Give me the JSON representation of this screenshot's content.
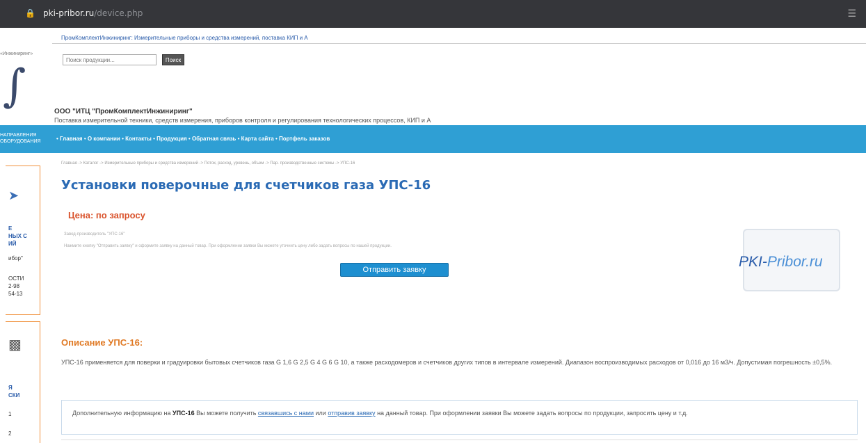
{
  "browser": {
    "url_domain": "pki-pribor.ru",
    "url_path": "/device.php"
  },
  "header": {
    "top_link": "ПромКомплектИнжиниринг: Измерительные приборы и средства измерений, поставка КИП и А",
    "search_placeholder": "Поиск продукции...",
    "search_button": "Поиск",
    "company_name": "ООО \"ИТЦ \"ПромКомплектИнжиниринг\"",
    "company_desc": "Поставка измерительной техники, средств измерения, приборов контроля и регулирования технологических процессов, КИП и А"
  },
  "nav": {
    "items": [
      "Главная",
      "О компании",
      "Контакты",
      "Продукция",
      "Обратная связь",
      "Карта сайта",
      "Портфель заказов"
    ]
  },
  "left_col": {
    "tag": "«Инжиниринг»",
    "blue_text_1": "НАПРАВЛЕНИЯ",
    "blue_text_2": "ОБОРУДОВАНИЯ",
    "box1_lines": [
      "Е",
      "НЫХ С",
      "ИЙ",
      "ибор\"",
      "ОСТИ",
      "2-98",
      "54-13"
    ],
    "box2_lines": [
      "Я",
      "СКИ",
      "1",
      "2"
    ]
  },
  "main": {
    "breadcrumb": "Главная -> Каталог -> Измерительные приборы и средства измерений -> Поток, расход, уровень, объем -> Пар. производственные системы -> УПС-16",
    "title": "Установки поверочные для счетчиков газа УПС-16",
    "price": "Цена: по запросу",
    "manufacturer": "Завод-производитель \"УПС-16\"",
    "order_hint": "Нажмите кнопку \"Отправить заявку\" и оформите заявку на данный товар. При оформлении заявки Вы можете уточнить цену либо задать вопросы по нашей продукции.",
    "order_button": "Отправить заявку",
    "logo_text_1": "PKI-",
    "logo_text_2": "Pribor.ru",
    "desc_title": "Описание УПС-16:",
    "desc_text": "УПС-16 применяется для поверки и градуировки бытовых счетчиков газа G 1,6 G 2,5 G 4 G 6 G 10, а также расходомеров и счетчиков других типов в интервале измерений. Диапазон воспроизводимых расходов от 0,016 до 16 м3/ч. Допустимая погрешность ±0,5%.",
    "info_prefix": "Дополнительную информацию на ",
    "info_product": "УПС-16",
    "info_mid1": " Вы можете получить ",
    "info_link1": "связавшись с нами",
    "info_mid2": " или ",
    "info_link2": "отправив заявку",
    "info_suffix": " на данный товар. При оформлении заявки Вы можете задать вопросы по продукции, запросить цену и т.д."
  }
}
